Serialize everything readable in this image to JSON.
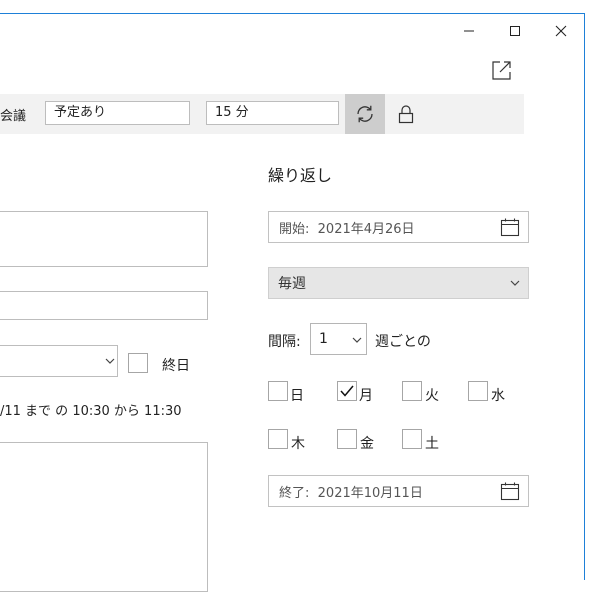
{
  "window": {
    "minimize_icon": "minimize-icon",
    "maximize_icon": "maximize-icon",
    "close_icon": "close-icon",
    "popout_icon": "popout-icon"
  },
  "toolbar": {
    "category_fragment": "会議",
    "show_as": "予定あり",
    "reminder": "15 分",
    "sync_icon": "sync-icon",
    "lock_icon": "lock-icon"
  },
  "left": {
    "allday_label": "終日",
    "summary": "/11 まで の  10:30 から 11:30"
  },
  "recurrence": {
    "title": "繰り返し",
    "start_label": "開始:",
    "start_date": "2021年4月26日",
    "pattern": "毎週",
    "interval_label": "間隔:",
    "interval_value": "1",
    "interval_suffix": "週ごとの",
    "days": [
      {
        "label": "日",
        "checked": false
      },
      {
        "label": "月",
        "checked": true
      },
      {
        "label": "火",
        "checked": false
      },
      {
        "label": "水",
        "checked": false
      },
      {
        "label": "木",
        "checked": false
      },
      {
        "label": "金",
        "checked": false
      },
      {
        "label": "土",
        "checked": false
      }
    ],
    "end_label": "終了:",
    "end_date": "2021年10月11日"
  },
  "colors": {
    "window_border": "#1e80d8",
    "toolbar_bg": "#f2f2f2",
    "sync_bg": "#cdcdcd",
    "select_bg": "#e6e6e6"
  }
}
